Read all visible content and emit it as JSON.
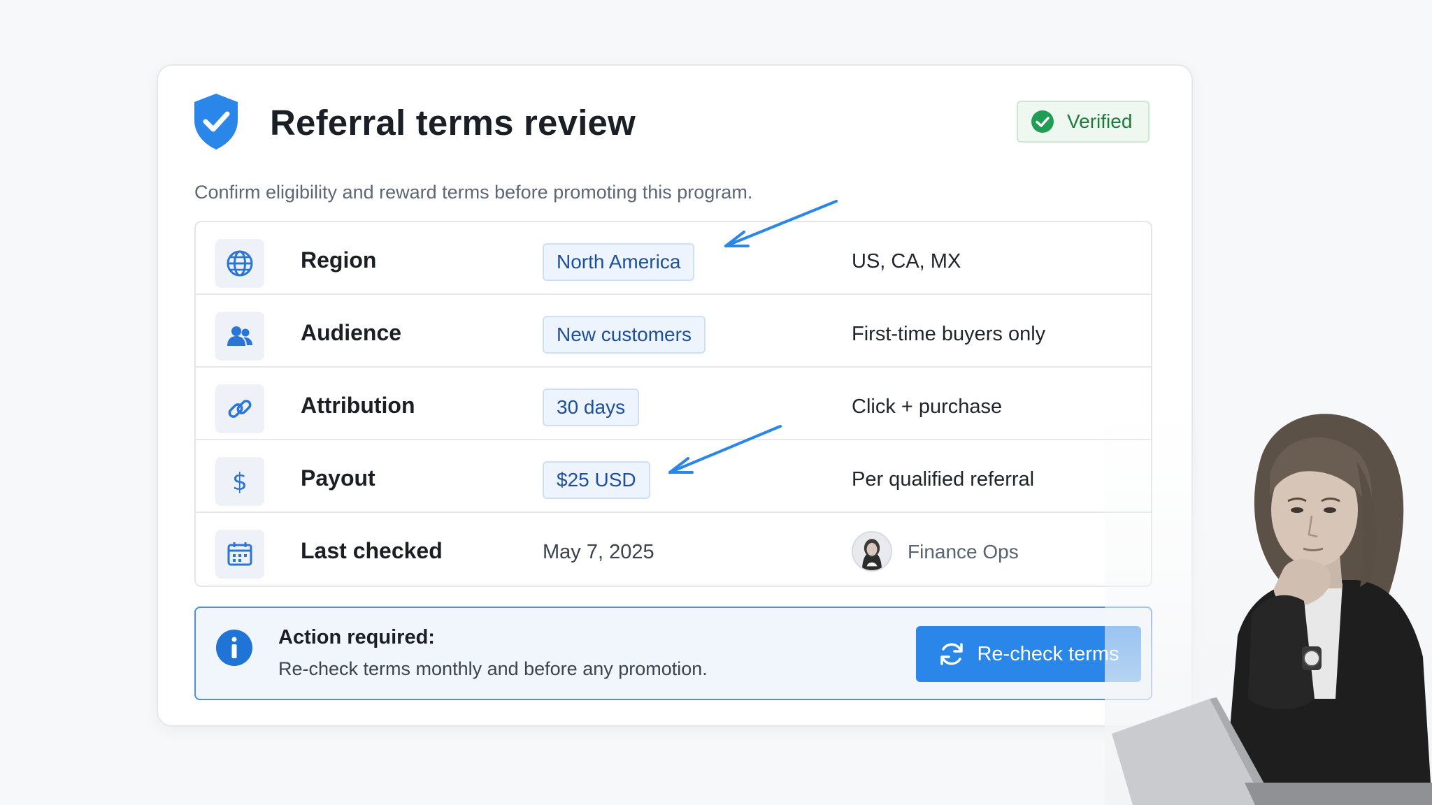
{
  "header": {
    "title": "Referral terms review",
    "badge": "Verified",
    "subtitle": "Confirm eligibility and reward terms before promoting this program."
  },
  "rows": [
    {
      "icon": "globe-icon",
      "label": "Region",
      "value": "North America",
      "note": "US, CA, MX"
    },
    {
      "icon": "users-icon",
      "label": "Audience",
      "value": "New customers",
      "note": "First-time buyers only"
    },
    {
      "icon": "link-icon",
      "label": "Attribution",
      "value": "30 days",
      "note": "Click + purchase"
    },
    {
      "icon": "dollar-icon",
      "label": "Payout",
      "value": "$25 USD",
      "note": "Per qualified referral"
    },
    {
      "icon": "calendar-icon",
      "label": "Last checked",
      "value": "May 7, 2025",
      "note": "Finance Ops"
    }
  ],
  "action": {
    "title": "Action required:",
    "text": "Re-check terms monthly and before any promotion.",
    "button_label": "Re-check terms"
  },
  "colors": {
    "accent": "#2a86e8",
    "verified_green": "#1f9d55",
    "chip_text": "#1c4f9c"
  }
}
